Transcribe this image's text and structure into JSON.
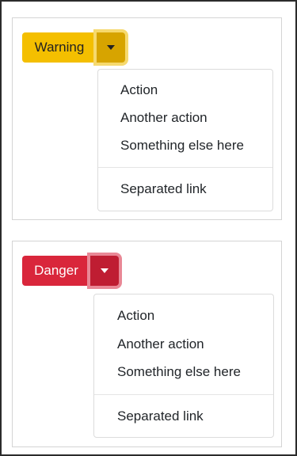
{
  "dropdowns": [
    {
      "variant": "warning",
      "button_label": "Warning",
      "button_color": "#f4bf00",
      "toggle_icon": "caret-down-icon",
      "menu": {
        "items": [
          "Action",
          "Another action",
          "Something else here"
        ],
        "separated_item": "Separated link"
      }
    },
    {
      "variant": "danger",
      "button_label": "Danger",
      "button_color": "#d9263b",
      "toggle_icon": "caret-down-icon",
      "menu": {
        "items": [
          "Action",
          "Another action",
          "Something else here"
        ],
        "separated_item": "Separated link"
      }
    }
  ]
}
